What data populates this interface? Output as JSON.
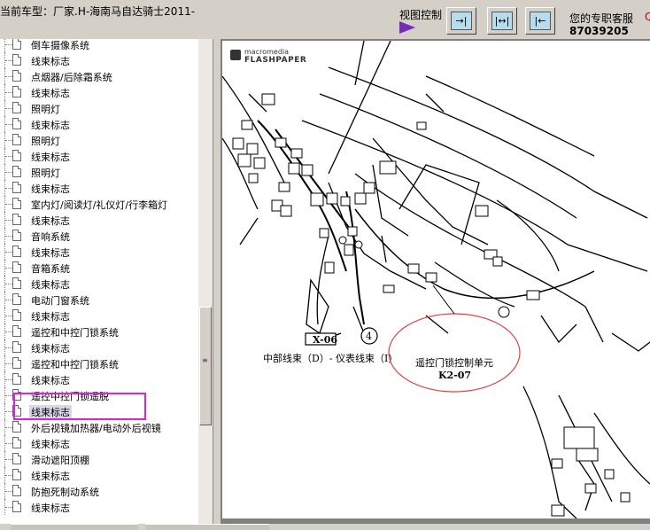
{
  "header": {
    "car_label": "当前车型：厂家.H-海南马自达骑士2011-",
    "view_label": "视图控制",
    "support_label": "您的专职客服",
    "support_q": "Q",
    "phone": "87039205",
    "buttons": [
      {
        "name": "fit-right",
        "glyph": "→|"
      },
      {
        "name": "fit-both",
        "glyph": "|↔|"
      },
      {
        "name": "fit-left",
        "glyph": "|←"
      }
    ]
  },
  "tree": {
    "items": [
      "倒车摄像系统",
      "线束标志",
      "点烟器/后除霜系统",
      "线束标志",
      "照明灯",
      "线束标志",
      "照明灯",
      "线束标志",
      "照明灯",
      "线束标志",
      "室内灯/阅读灯/礼仪灯/行李箱灯",
      "线束标志",
      "音响系统",
      "线束标志",
      "音箱系统",
      "线束标志",
      "电动门窗系统",
      "线束标志",
      "遥控和中控门锁系统",
      "线束标志",
      "遥控和中控门锁系统",
      "线束标志",
      "遥控中控门锁遥脱",
      "线束标志",
      "外后视镜加热器/电动外后视镜",
      "线束标志",
      "滑动遮阳顶棚",
      "线束标志",
      "防抱死制动系统",
      "线束标志"
    ],
    "selected_index": 23
  },
  "document": {
    "logo_top": "macromedia",
    "logo_bottom": "FLASHPAPER",
    "labels": {
      "x06": "X-06",
      "circle4": "4",
      "harness": "中部线束（D）- 仪表线束（I）",
      "unit": "遥控门锁控制单元",
      "unit_code": "K2-07"
    }
  }
}
